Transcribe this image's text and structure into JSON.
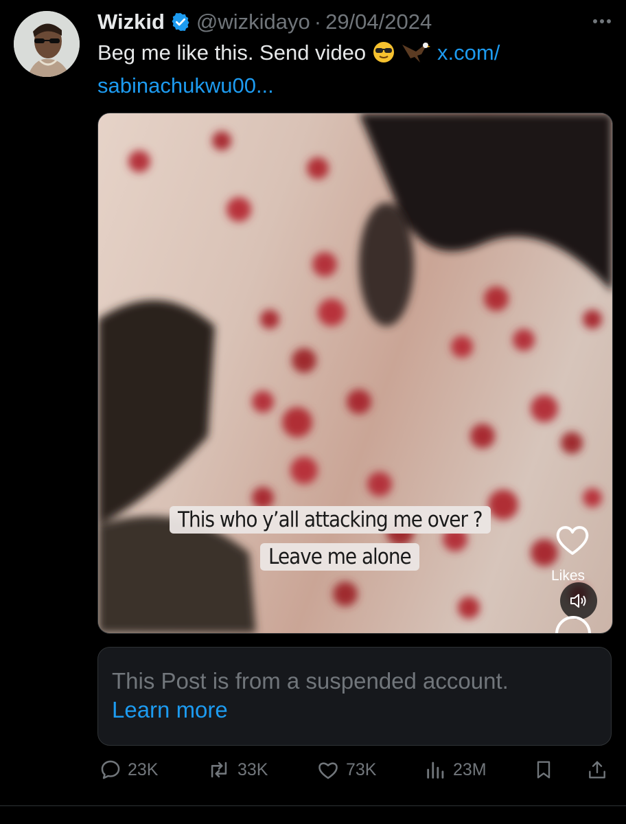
{
  "post": {
    "author_name": "Wizkid",
    "handle": "@wizkidayo",
    "separator": "·",
    "date": "29/04/2024",
    "text": "Beg me like this. Send video",
    "link_part1": "x.com/",
    "link_part2": "sabinachukwu00..."
  },
  "media": {
    "caption_line1": "This who y’all attacking me over ?",
    "caption_line2": "Leave me alone",
    "likes_label": "Likes"
  },
  "suspended_notice": {
    "text": "This Post is from a suspended account.",
    "learn_more": "Learn more"
  },
  "actions": {
    "replies": "23K",
    "reposts": "33K",
    "likes": "73K",
    "views": "23M"
  },
  "colors": {
    "background": "#000000",
    "link": "#1d9bf0",
    "muted": "#71767b",
    "verified": "#1d9bf0"
  },
  "icons": [
    "verified-icon",
    "more-icon",
    "sunglasses-emoji",
    "eagle-emoji",
    "heart-icon",
    "speaker-icon",
    "reply-icon",
    "repost-icon",
    "like-icon",
    "views-icon",
    "bookmark-icon",
    "share-icon"
  ]
}
